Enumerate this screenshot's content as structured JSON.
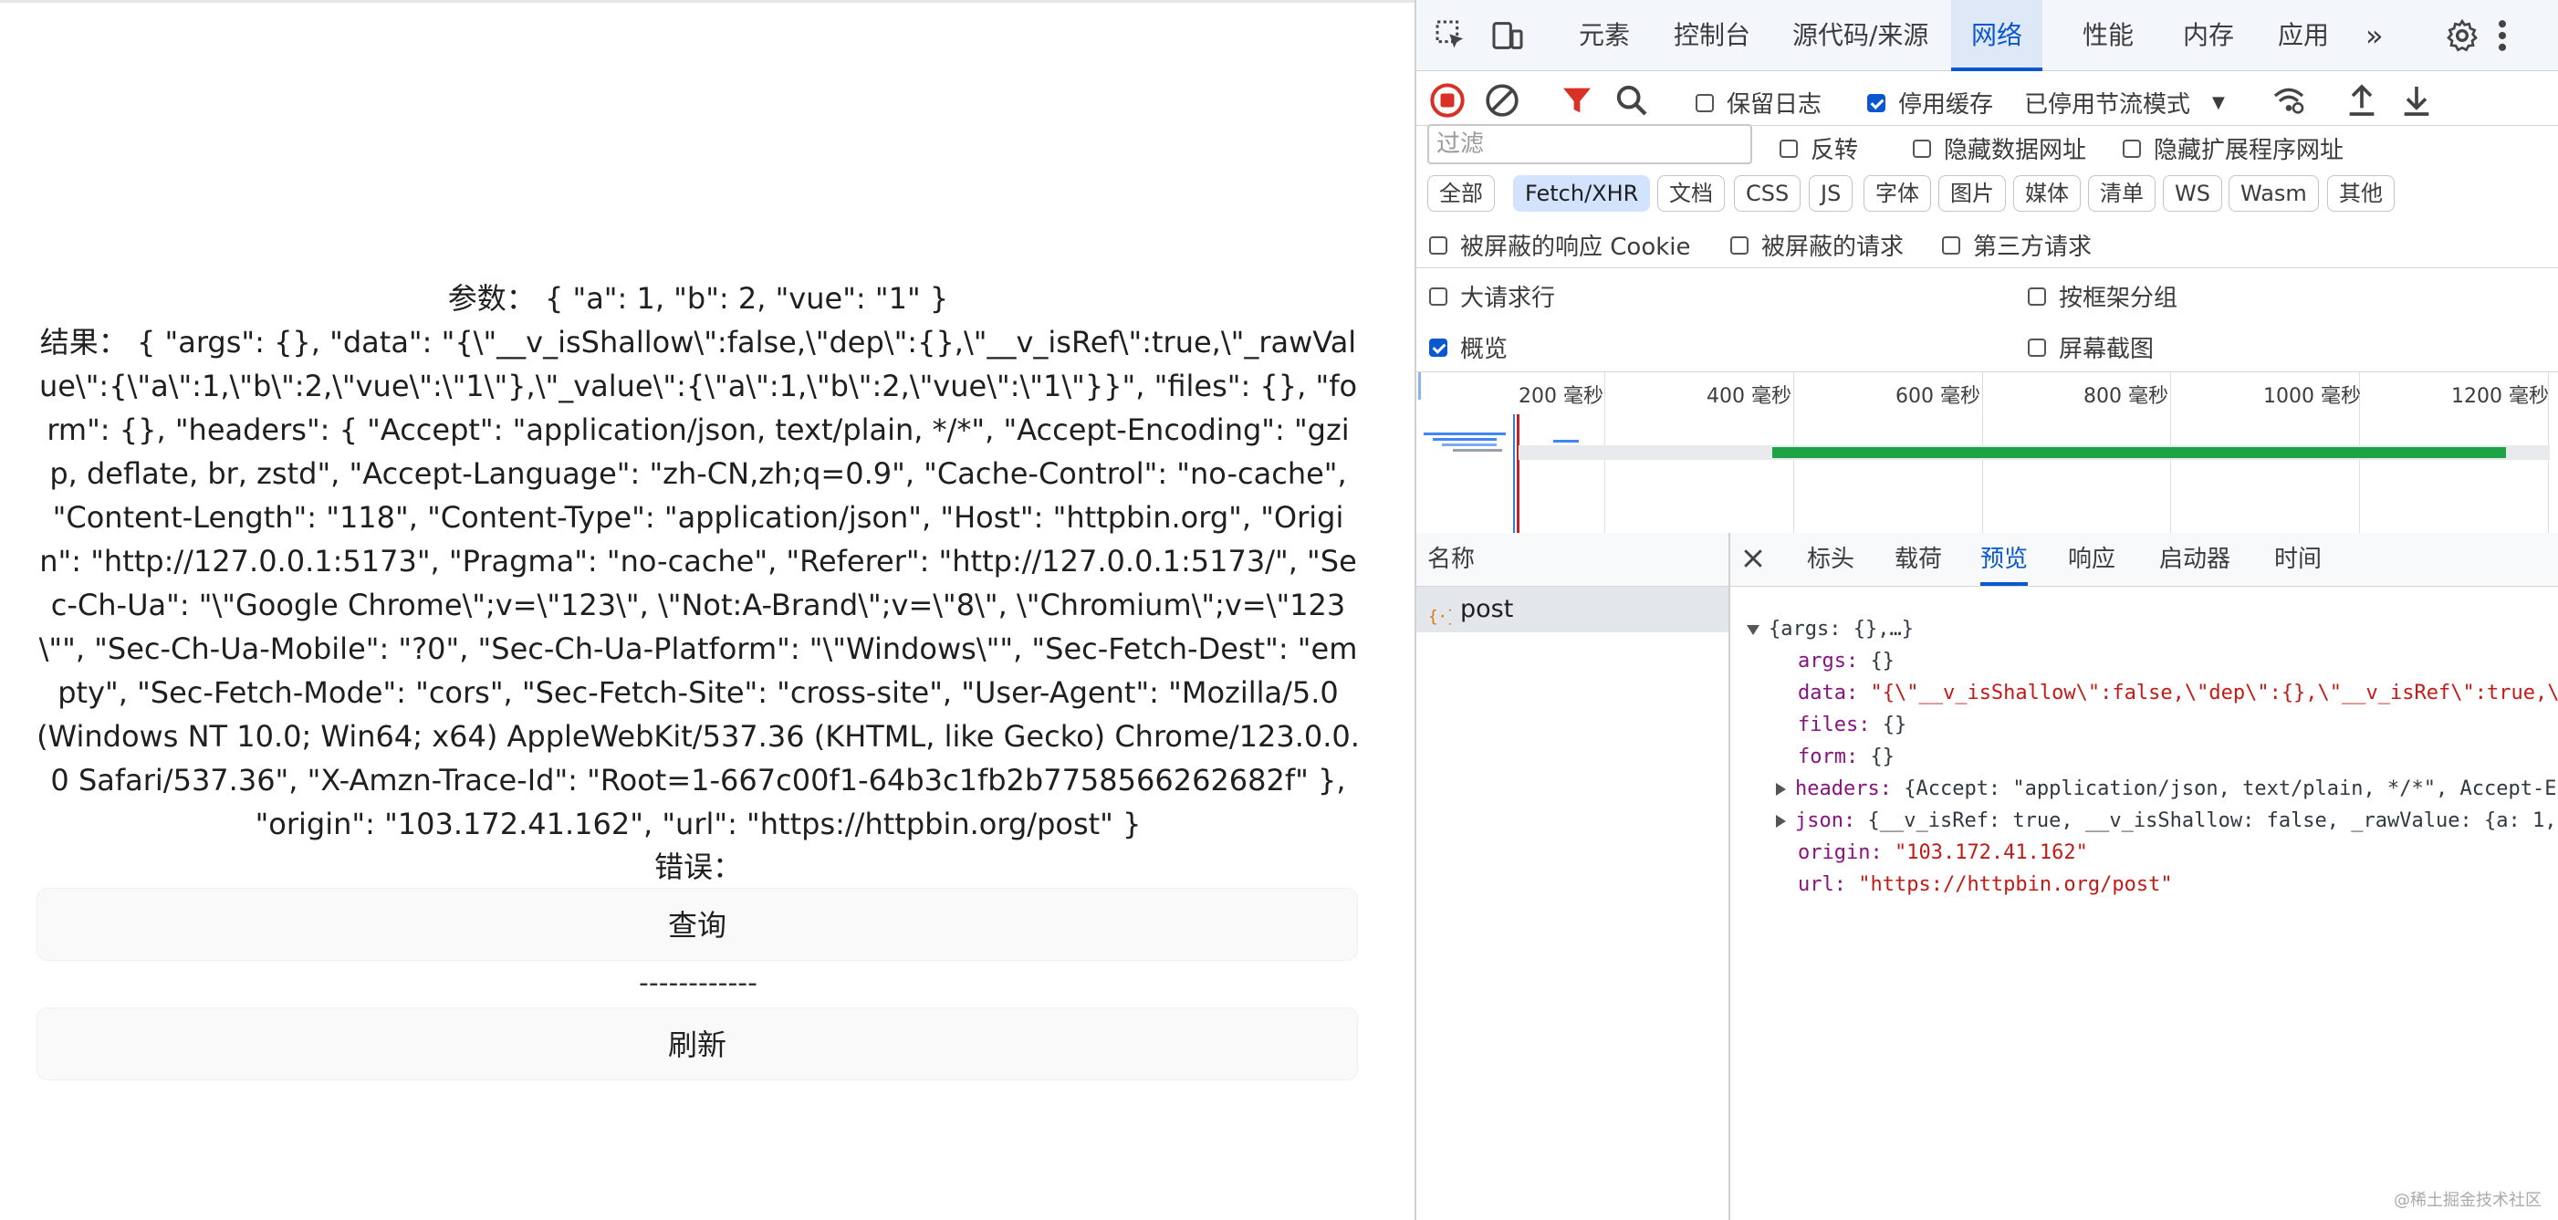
{
  "page": {
    "params_line": "参数： { \"a\": 1, \"b\": 2, \"vue\": \"1\" }",
    "result_line": "结果： { \"args\": {}, \"data\": \"{\\\"__v_isShallow\\\":false,\\\"dep\\\":{},\\\"__v_isRef\\\":true,\\\"_rawValue\\\":{\\\"a\\\":1,\\\"b\\\":2,\\\"vue\\\":\\\"1\\\"},\\\"_value\\\":{\\\"a\\\":1,\\\"b\\\":2,\\\"vue\\\":\\\"1\\\"}}\", \"files\": {}, \"form\": {}, \"headers\": { \"Accept\": \"application/json, text/plain, */*\", \"Accept-Encoding\": \"gzip, deflate, br, zstd\", \"Accept-Language\": \"zh-CN,zh;q=0.9\", \"Cache-Control\": \"no-cache\", \"Content-Length\": \"118\", \"Content-Type\": \"application/json\", \"Host\": \"httpbin.org\", \"Origin\": \"http://127.0.0.1:5173\", \"Pragma\": \"no-cache\", \"Referer\": \"http://127.0.0.1:5173/\", \"Sec-Ch-Ua\": \"\\\"Google Chrome\\\";v=\\\"123\\\", \\\"Not:A-Brand\\\";v=\\\"8\\\", \\\"Chromium\\\";v=\\\"123\\\"\", \"Sec-Ch-Ua-Mobile\": \"?0\", \"Sec-Ch-Ua-Platform\": \"\\\"Windows\\\"\", \"Sec-Fetch-Dest\": \"empty\", \"Sec-Fetch-Mode\": \"cors\", \"Sec-Fetch-Site\": \"cross-site\", \"User-Agent\": \"Mozilla/5.0 (Windows NT 10.0; Win64; x64) AppleWebKit/537.36 (KHTML, like Gecko) Chrome/123.0.0.0 Safari/537.36\", \"X-Amzn-Trace-Id\": \"Root=1-667c00f1-64b3c1fb2b7758566262682f\" }, \"origin\": \"103.172.41.162\", \"url\": \"https://httpbin.org/post\" }",
    "error_line": "错误：",
    "query_button": "查询",
    "separator": "------------",
    "refresh_button": "刷新"
  },
  "devtools": {
    "tabs": [
      "元素",
      "控制台",
      "源代码/来源",
      "网络",
      "性能",
      "内存",
      "应用"
    ],
    "active_tab": "网络",
    "more_tabs": "»",
    "toolbar": {
      "preserve_log": "保留日志",
      "disable_cache": "停用缓存",
      "throttling": "已停用节流模式"
    },
    "filter": {
      "placeholder": "过滤",
      "invert": "反转",
      "hide_data_urls": "隐藏数据网址",
      "hide_extension_urls": "隐藏扩展程序网址"
    },
    "types": [
      "全部",
      "Fetch/XHR",
      "文档",
      "CSS",
      "JS",
      "字体",
      "图片",
      "媒体",
      "清单",
      "WS",
      "Wasm",
      "其他"
    ],
    "active_type": "Fetch/XHR",
    "blocked": {
      "blocked_cookies": "被屏蔽的响应 Cookie",
      "blocked_requests": "被屏蔽的请求",
      "third_party": "第三方请求"
    },
    "options": {
      "large_rows": "大请求行",
      "group_by_frame": "按框架分组",
      "overview": "概览",
      "screenshots": "屏幕截图"
    },
    "timeline_labels": [
      "200 毫秒",
      "400 毫秒",
      "600 毫秒",
      "800 毫秒",
      "1000 毫秒",
      "1200 毫秒"
    ],
    "name_header": "名称",
    "request_name": "post",
    "detail_tabs": [
      "标头",
      "载荷",
      "预览",
      "响应",
      "启动器",
      "时间"
    ],
    "active_detail_tab": "预览",
    "preview": {
      "root": "{args: {},…}",
      "args_key": "args:",
      "args_val": "{}",
      "data_key": "data:",
      "data_val": "\"{\\\"__v_isShallow\\\":false,\\\"dep\\\":{},\\\"__v_isRef\\\":true,\\",
      "files_key": "files:",
      "files_val": "{}",
      "form_key": "form:",
      "form_val": "{}",
      "headers_key": "headers:",
      "headers_val": "{Accept: \"application/json, text/plain, */*\", Accept-E",
      "json_key": "json:",
      "json_val": "{__v_isRef: true, __v_isShallow: false, _rawValue: {a: 1,",
      "origin_key": "origin:",
      "origin_val": "\"103.172.41.162\"",
      "url_key": "url:",
      "url_val": "\"https://httpbin.org/post\""
    }
  },
  "watermark": "@稀土掘金技术社区",
  "colors": {
    "accent": "#0b57d0",
    "active_chip": "#d3e3fd",
    "record_stop": "#d93025",
    "waterfall_bar": "#1ea446"
  }
}
